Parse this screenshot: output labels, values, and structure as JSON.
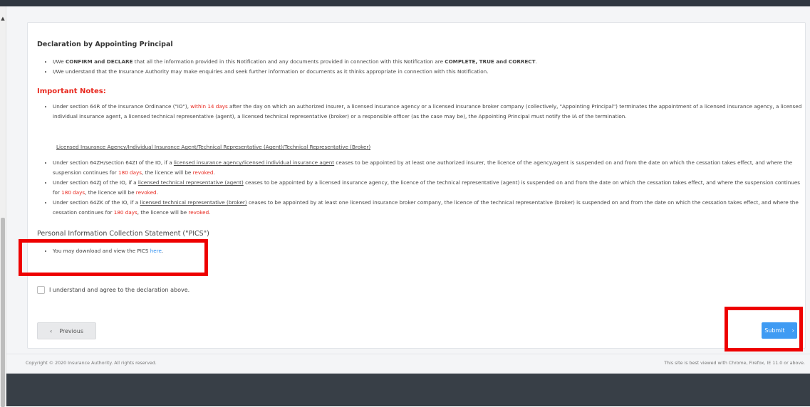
{
  "declaration": {
    "heading": "Declaration by Appointing Principal",
    "items": [
      {
        "p1": "I/We ",
        "b1": "CONFIRM and DECLARE",
        "p2": " that all the information provided in this Notification and any documents provided in connection with this Notification are ",
        "b2": "COMPLETE, TRUE and CORRECT",
        "p3": "."
      },
      {
        "text": "I/We understand that the Insurance Authority may make enquiries and seek further information or documents as it thinks appropriate in connection with this Notification."
      }
    ]
  },
  "notes": {
    "title": "Important Notes:",
    "first": {
      "pre": "Under section 64R of the Insurance Ordinance (\"IO\"), ",
      "red": "within 14 days",
      "post": " after the day on which an authorized insurer, a licensed insurance agency or a licensed insurance broker company (collectively, \"Appointing Principal\") terminates the appointment of a licensed insurance agency, a licensed individual insurance agent, a licensed technical representative (agent), a licensed technical representative (broker) or a responsible officer (as the case may be), the Appointing Principal must notify the IA of the termination."
    },
    "subtitle": "Licensed Insurance Agency/Individual Insurance Agent/Technical Representative (Agent)/Technical Representative (Broker)",
    "items": [
      {
        "pre": "Under section 64ZH/section 64ZI of the IO, if a ",
        "u": "licensed insurance agency/licensed individual insurance agent",
        "mid": " ceases to be appointed by at least one authorized insurer, the licence of the agency/agent is suspended on and from the date on which the cessation takes effect, and where the suspension continues for ",
        "days": "180 days",
        "end": ", the licence will be ",
        "revoked": "revoked",
        "dot": "."
      },
      {
        "pre": "Under section 64ZJ of the IO, if a ",
        "u": "licensed technical representative (agent)",
        "mid": " ceases to be appointed by a licensed insurance agency, the licence of the technical representative (agent) is suspended on and from the date on which the cessation takes effect, and where the suspension continues for ",
        "days": "180 days",
        "end": ", the licence will be ",
        "revoked": "revoked",
        "dot": "."
      },
      {
        "pre": "Under section 64ZK of the IO, if a ",
        "u": "licensed technical representative (broker)",
        "mid": " ceases to be appointed by at least one licensed insurance broker company, the licence of the technical representative (broker) is suspended on and from the date on which the cessation takes effect, and where the cessation continues for ",
        "days": "180 days",
        "end": ", the licence will be ",
        "revoked": "revoked",
        "dot": "."
      }
    ]
  },
  "pics": {
    "title": "Personal Information Collection Statement (\"PICS\")",
    "text": "You may download and view the PICS ",
    "link": "here",
    "dot": "."
  },
  "agree_label": "I understand and agree to the declaration above.",
  "buttons": {
    "previous": "Previous",
    "submit": "Submit",
    "prev_chevron": "‹",
    "next_chevron": "›"
  },
  "footer": {
    "copyright": "Copyright © 2020 Insurance Authority. All rights reserved.",
    "best_view": "This site is best viewed with Chrome, Firefox, IE 11.0 or above."
  },
  "colors": {
    "accent": "#3f9bf3",
    "important": "#e8261c",
    "highlight": "#ee0000",
    "dark_bar": "#383f47"
  }
}
